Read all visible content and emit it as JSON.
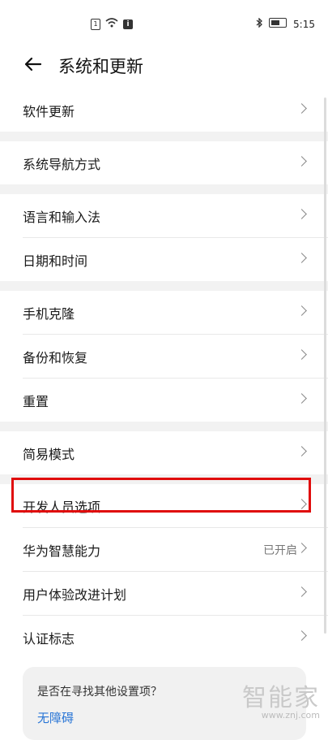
{
  "status": {
    "time": "5:15",
    "sim_label": "1",
    "i_label": "i"
  },
  "header": {
    "title": "系统和更新"
  },
  "groups": [
    {
      "items": [
        {
          "label": "软件更新"
        }
      ]
    },
    {
      "items": [
        {
          "label": "系统导航方式"
        }
      ]
    },
    {
      "items": [
        {
          "label": "语言和输入法"
        },
        {
          "label": "日期和时间"
        }
      ]
    },
    {
      "items": [
        {
          "label": "手机克隆"
        },
        {
          "label": "备份和恢复"
        },
        {
          "label": "重置"
        }
      ]
    },
    {
      "items": [
        {
          "label": "简易模式"
        }
      ]
    },
    {
      "items": [
        {
          "label": "开发人员选项"
        },
        {
          "label": "华为智慧能力",
          "value": "已开启"
        },
        {
          "label": "用户体验改进计划"
        },
        {
          "label": "认证标志"
        }
      ]
    }
  ],
  "search_card": {
    "question": "是否在寻找其他设置项？",
    "link": "无障碍"
  },
  "watermark": {
    "main": "智能家",
    "url": "www.znj.com"
  },
  "colors": {
    "highlight": "#e00c0c",
    "link": "#2a76d6"
  }
}
